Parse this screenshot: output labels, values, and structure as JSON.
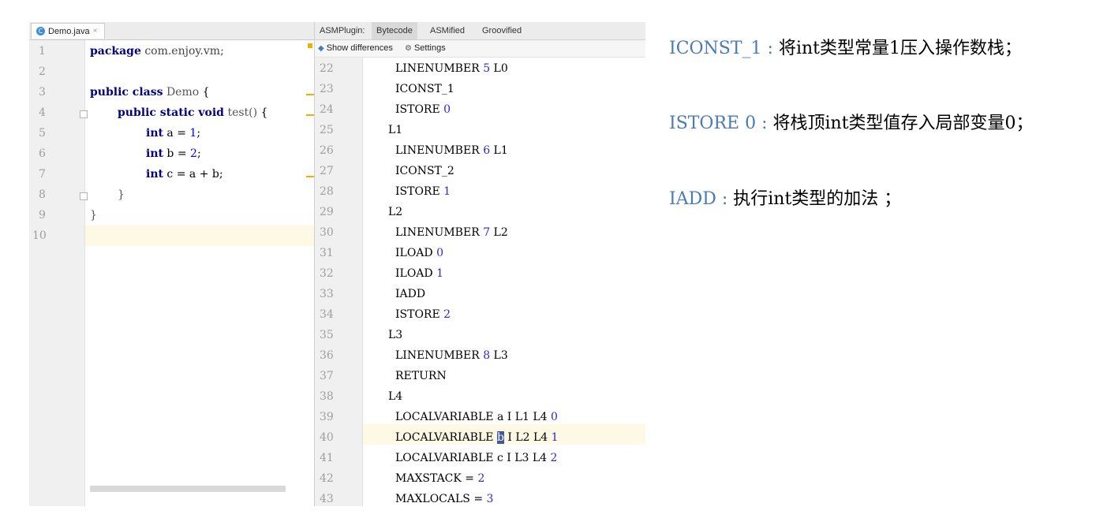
{
  "editor": {
    "file_tab": "Demo.java",
    "file_icon": "java-class-icon",
    "line_numbers": [
      "1",
      "2",
      "3",
      "4",
      "5",
      "6",
      "7",
      "8",
      "9",
      "10"
    ],
    "code": {
      "l1_kw": "package",
      "l1_rest": "com.enjoy.vm;",
      "l3_kw": "public class",
      "l3_name": "Demo",
      "l3_brace": "{",
      "l4_kw": "public static void",
      "l4_name": "test()",
      "l4_brace": "{",
      "l5_kw": "int",
      "l5_a": "a = ",
      "l5_val": "1",
      "l5_end": ";",
      "l6_kw": "int",
      "l6_a": "b = ",
      "l6_val": "2",
      "l6_end": ";",
      "l7_kw": "int",
      "l7_a": "c = a + b;",
      "l8": "}",
      "l9": "}"
    }
  },
  "asm_panel": {
    "label": "ASMPlugin:",
    "tabs": [
      "Bytecode",
      "ASMified",
      "Groovified"
    ],
    "active_tab": "Bytecode",
    "toolbar": {
      "show_differences": "Show differences",
      "settings": "Settings"
    },
    "line_numbers": [
      "22",
      "23",
      "24",
      "25",
      "26",
      "27",
      "28",
      "29",
      "30",
      "31",
      "32",
      "33",
      "34",
      "35",
      "36",
      "37",
      "38",
      "39",
      "40",
      "41",
      "42",
      "43"
    ],
    "lines": [
      {
        "text": "LINENUMBER ",
        "num": "5",
        "tail": " L0",
        "indent": 2
      },
      {
        "text": "ICONST_1",
        "num": "",
        "tail": "",
        "indent": 2
      },
      {
        "text": "ISTORE ",
        "num": "0",
        "tail": "",
        "indent": 2
      },
      {
        "text": "L1",
        "num": "",
        "tail": "",
        "indent": 1
      },
      {
        "text": "LINENUMBER ",
        "num": "6",
        "tail": " L1",
        "indent": 2
      },
      {
        "text": "ICONST_2",
        "num": "",
        "tail": "",
        "indent": 2
      },
      {
        "text": "ISTORE ",
        "num": "1",
        "tail": "",
        "indent": 2
      },
      {
        "text": "L2",
        "num": "",
        "tail": "",
        "indent": 1
      },
      {
        "text": "LINENUMBER ",
        "num": "7",
        "tail": " L2",
        "indent": 2
      },
      {
        "text": "ILOAD ",
        "num": "0",
        "tail": "",
        "indent": 2
      },
      {
        "text": "ILOAD ",
        "num": "1",
        "tail": "",
        "indent": 2
      },
      {
        "text": "IADD",
        "num": "",
        "tail": "",
        "indent": 2
      },
      {
        "text": "ISTORE ",
        "num": "2",
        "tail": "",
        "indent": 2
      },
      {
        "text": "L3",
        "num": "",
        "tail": "",
        "indent": 1
      },
      {
        "text": "LINENUMBER ",
        "num": "8",
        "tail": " L3",
        "indent": 2
      },
      {
        "text": "RETURN",
        "num": "",
        "tail": "",
        "indent": 2
      },
      {
        "text": "L4",
        "num": "",
        "tail": "",
        "indent": 1
      },
      {
        "text": "LOCALVARIABLE a I L1 L4 ",
        "num": "0",
        "tail": "",
        "indent": 2
      },
      {
        "text": "LOCALVARIABLE ",
        "sel": "b",
        "rest": " I L2 L4 ",
        "num": "1",
        "tail": "",
        "indent": 2
      },
      {
        "text": "LOCALVARIABLE c I L3 L4 ",
        "num": "2",
        "tail": "",
        "indent": 2
      },
      {
        "text": "MAXSTACK = ",
        "num": "2",
        "tail": "",
        "indent": 2
      },
      {
        "text": "MAXLOCALS = ",
        "num": "3",
        "tail": "",
        "indent": 2
      }
    ]
  },
  "notes": [
    {
      "op": "ICONST_1",
      "sep": " : ",
      "desc": " 将int类型常量1压入操作数栈；"
    },
    {
      "op": "ISTORE 0",
      "sep": " : ",
      "desc": " 将栈顶int类型值存入局部变量0；"
    },
    {
      "op": "IADD",
      "sep": " : ",
      "desc": "执行int类型的加法 ；"
    }
  ]
}
